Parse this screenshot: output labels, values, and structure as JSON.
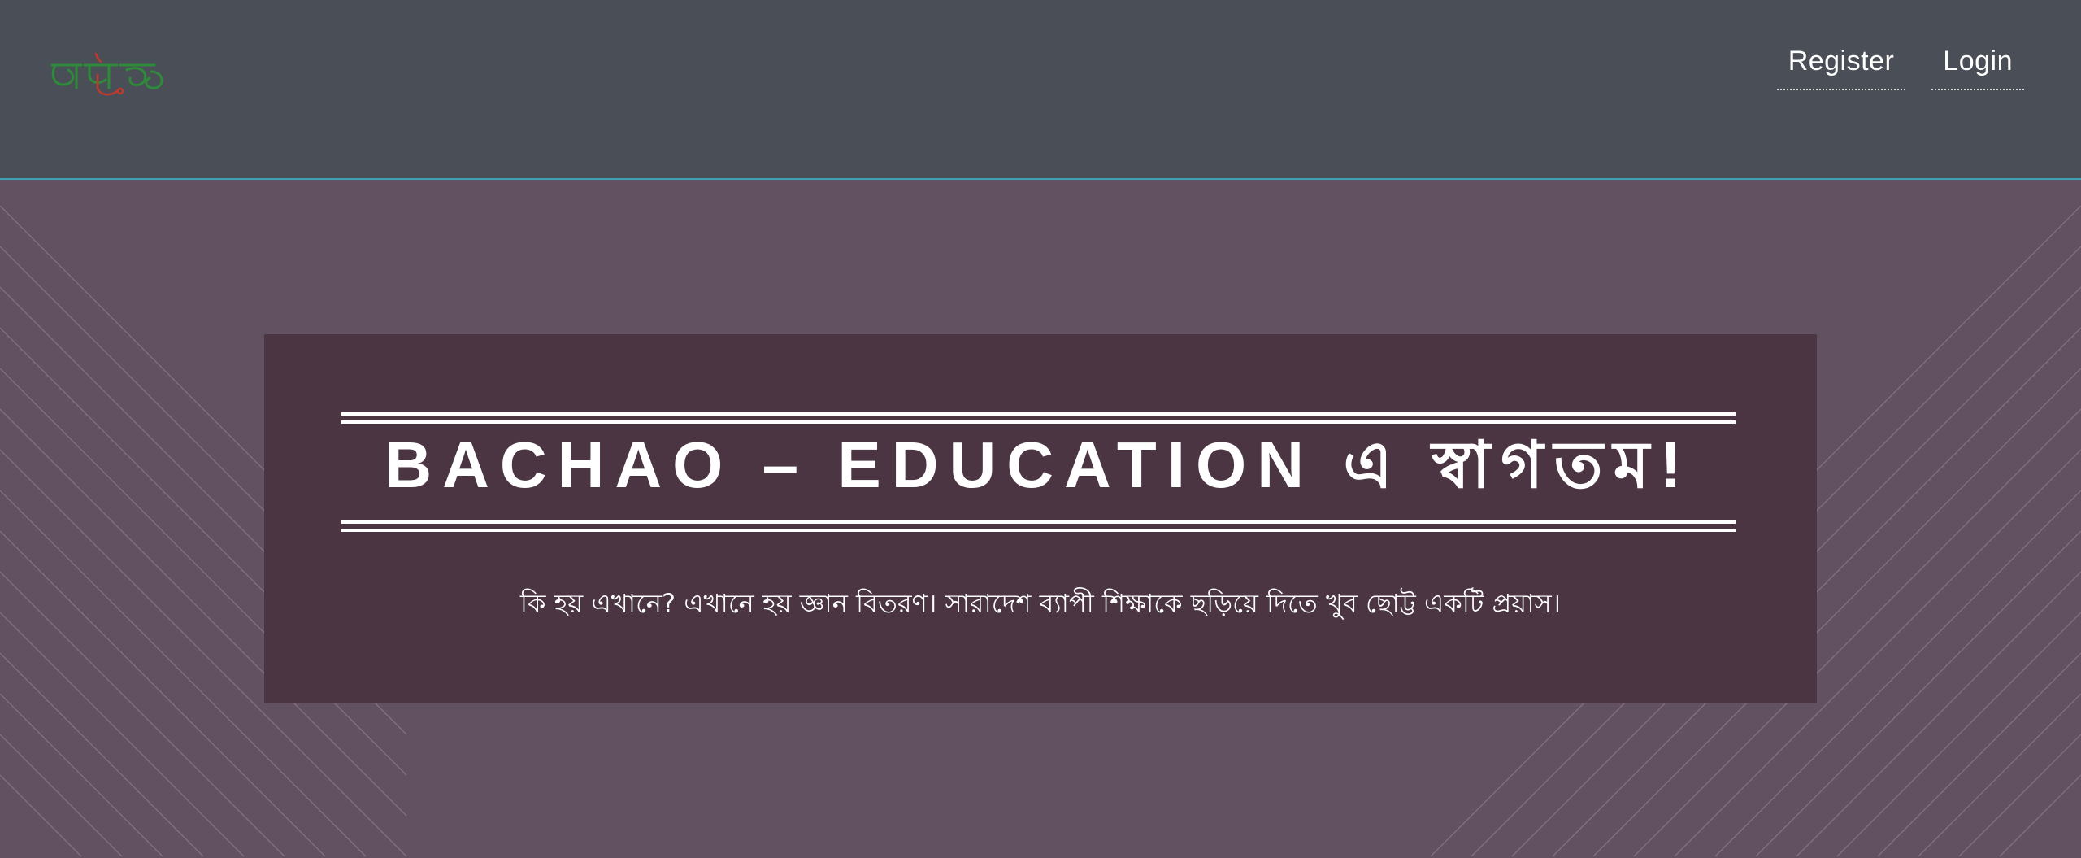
{
  "header": {
    "logo_text": "বাচাও",
    "nav": {
      "register_label": "Register",
      "login_label": "Login"
    }
  },
  "hero": {
    "title": "BACHAO – EDUCATION এ স্বাগতম!",
    "subtitle": "কি হয় এখানে? এখানে হয় জ্ঞান বিতরণ। সারাদেশ ব্যাপী শিক্ষাকে ছড়িয়ে দিতে খুব ছোট্ট একটি প্রয়াস।"
  },
  "colors": {
    "header_bg": "#4a4e56",
    "header_border": "#3fa2b0",
    "hero_bg": "#625160",
    "banner_bg": "#4b3543",
    "logo_green": "#2e8b3a",
    "logo_red": "#c0392b"
  }
}
